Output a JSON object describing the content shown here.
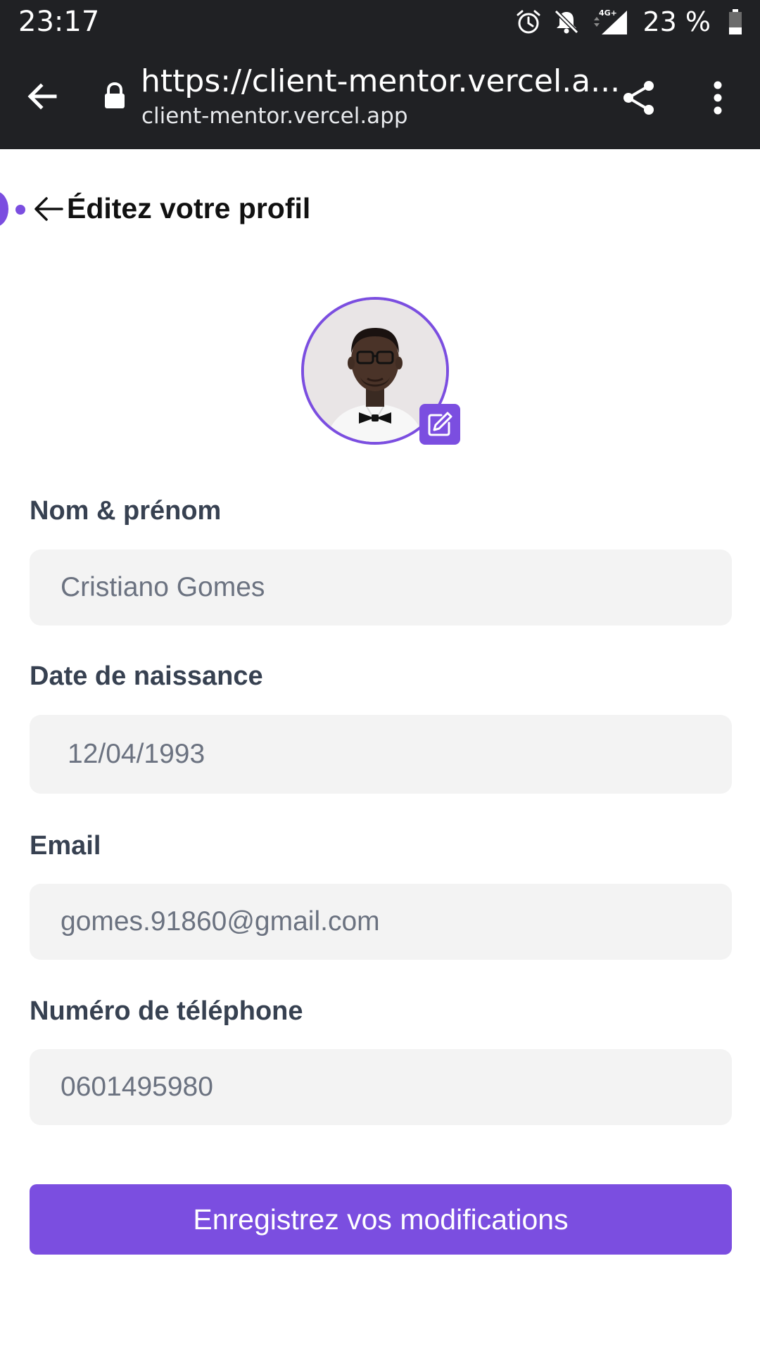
{
  "status_bar": {
    "time": "23:17",
    "battery_percent": "23 %",
    "network": "4G+",
    "icons": [
      "alarm-icon",
      "notifications-off-icon",
      "signal-icon",
      "battery-icon"
    ]
  },
  "browser": {
    "url": "https://client-mentor.vercel.a...",
    "domain": "client-mentor.vercel.app",
    "icons": [
      "back-arrow-icon",
      "lock-icon",
      "share-icon",
      "more-vert-icon"
    ]
  },
  "page": {
    "title": "Éditez votre profil"
  },
  "avatar": {
    "icon": "edit-icon"
  },
  "form": {
    "full_name": {
      "label": "Nom & prénom",
      "value": "Cristiano Gomes"
    },
    "birth_date": {
      "label": "Date de naissance",
      "value": "12/04/1993"
    },
    "email": {
      "label": "Email",
      "value": "gomes.91860@gmail.com"
    },
    "phone": {
      "label": "Numéro de téléphone",
      "value": "0601495980"
    }
  },
  "actions": {
    "save_label": "Enregistrez vos modifications"
  },
  "colors": {
    "accent": "#7b4ee0",
    "browser_bar": "#202124",
    "input_bg": "#f3f3f3"
  }
}
